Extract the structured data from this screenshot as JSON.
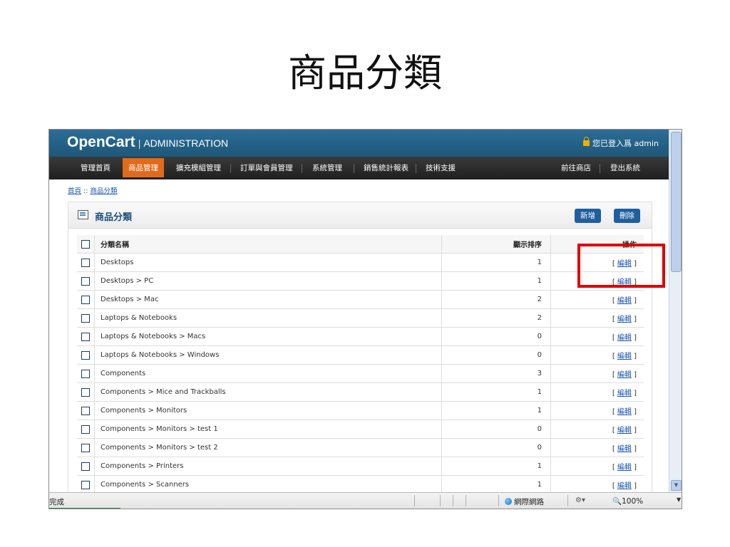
{
  "slide": {
    "title": "商品分類"
  },
  "header": {
    "logo_main": "OpenCart",
    "logo_sep": "|",
    "logo_sub": "ADMINISTRATION",
    "login": "您已登入爲 admin"
  },
  "menu": {
    "items": [
      "管理首頁",
      "商品管理",
      "擴充模組管理",
      "訂單與會員管理",
      "系統管理",
      "銷售統計報表",
      "技術支援"
    ],
    "right": [
      "前往商店",
      "登出系統"
    ]
  },
  "breadcrumb": {
    "home": "首頁",
    "sep": "::",
    "current": "商品分類"
  },
  "box": {
    "title": "商品分類",
    "add": "新增",
    "delete": "刪除"
  },
  "table": {
    "headers": {
      "name": "分類名稱",
      "order": "顯示排序",
      "action": "操作"
    },
    "action_label": "編輯",
    "rows": [
      {
        "name": "Desktops",
        "order": "1"
      },
      {
        "name": "Desktops > PC",
        "order": "1"
      },
      {
        "name": "Desktops > Mac",
        "order": "2"
      },
      {
        "name": "Laptops & Notebooks",
        "order": "2"
      },
      {
        "name": "Laptops & Notebooks > Macs",
        "order": "0"
      },
      {
        "name": "Laptops & Notebooks > Windows",
        "order": "0"
      },
      {
        "name": "Components",
        "order": "3"
      },
      {
        "name": "Components > Mice and Trackballs",
        "order": "1"
      },
      {
        "name": "Components > Monitors",
        "order": "1"
      },
      {
        "name": "Components > Monitors > test 1",
        "order": "0"
      },
      {
        "name": "Components > Monitors > test 2",
        "order": "0"
      },
      {
        "name": "Components > Printers",
        "order": "1"
      },
      {
        "name": "Components > Scanners",
        "order": "1"
      }
    ]
  },
  "status": {
    "text": "完成",
    "zone": "網際網路",
    "zoom": "100%"
  },
  "colors": {
    "header_bg": "#1e5778",
    "menu_bg": "#2a2a2a",
    "active_tab": "#e06b1c",
    "highlight": "#e00000",
    "link": "#1b57b1"
  }
}
